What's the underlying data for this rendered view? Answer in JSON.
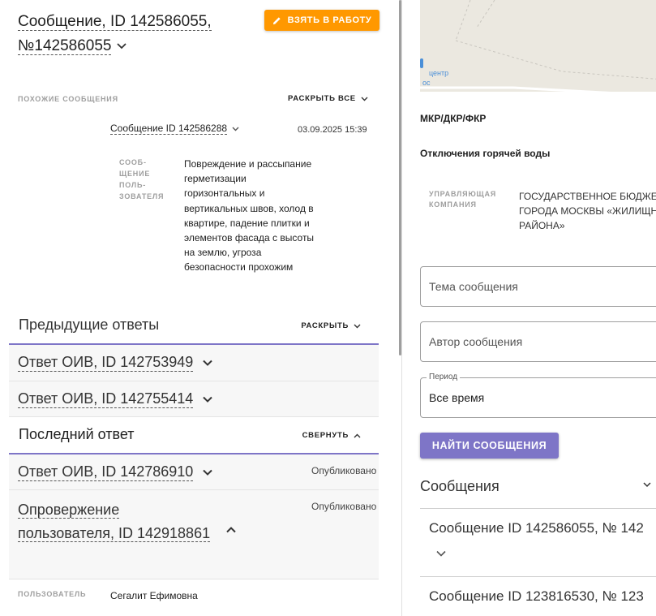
{
  "header": {
    "title": "Сообщение, ID 142586055, №142586055",
    "take_button": "ВЗЯТЬ В РАБОТУ"
  },
  "similar": {
    "caption": "ПОХОЖИЕ СООБЩЕНИЯ",
    "expand_all": "РАСКРЫТЬ ВСЕ",
    "item": {
      "link": "Сообщение ID 142586288",
      "date": "03.09.2025 15:39",
      "user_msg_caption": "СООБ-ЩЕНИЕ ПОЛЬ-ЗОВАТЕЛЯ",
      "user_msg_text": "Повреждение и рассыпание герметизации горизонтальных и вертикальных швов, холод в квартире, падение плитки и элементов фасада с высоты на землю, угроза безопасности прохожим"
    }
  },
  "previous": {
    "title": "Предыдущие ответы",
    "toggle": "РАСКРЫТЬ",
    "items": [
      {
        "label": "Ответ ОИВ, ID 142753949"
      },
      {
        "label": "Ответ ОИВ, ID 142755414"
      }
    ]
  },
  "last": {
    "title": "Последний ответ",
    "toggle": "СВЕРНУТЬ",
    "items": [
      {
        "label": "Ответ ОИВ, ID 142786910",
        "status": "Опубликовано"
      },
      {
        "label": "Опровержение пользователя, ID 142918861",
        "status": "Опубликовано"
      }
    ],
    "user_caption": "ПОЛЬЗОВАТЕЛЬ",
    "user_value": "Сегалит Ефимовна"
  },
  "right": {
    "map_label": "центр",
    "map_label2": "ос",
    "mkr": "МКР/ДКР/ФКР",
    "outage": "Отключения горячей воды",
    "manager_caption": "УПРАВЛЯЮЩАЯ КОМПАНИЯ",
    "manager_value_1": "ГОСУДАРСТВЕННОЕ БЮДЖЕТ",
    "manager_value_2": "ГОРОДА МОСКВЫ «ЖИЛИЩН",
    "manager_value_3": "РАЙОНА»",
    "topic_placeholder": "Тема сообщения",
    "author_placeholder": "Автор сообщения",
    "period_label": "Период",
    "period_value": "Все время",
    "find_button": "НАЙТИ СООБЩЕНИЯ",
    "messages_title": "Сообщения",
    "messages": [
      {
        "label": "Сообщение ID 142586055, № 142"
      },
      {
        "label": "Сообщение ID 123816530, № 123"
      }
    ]
  },
  "colors": {
    "orange": "#ff9800",
    "purple": "#7e75c7"
  }
}
